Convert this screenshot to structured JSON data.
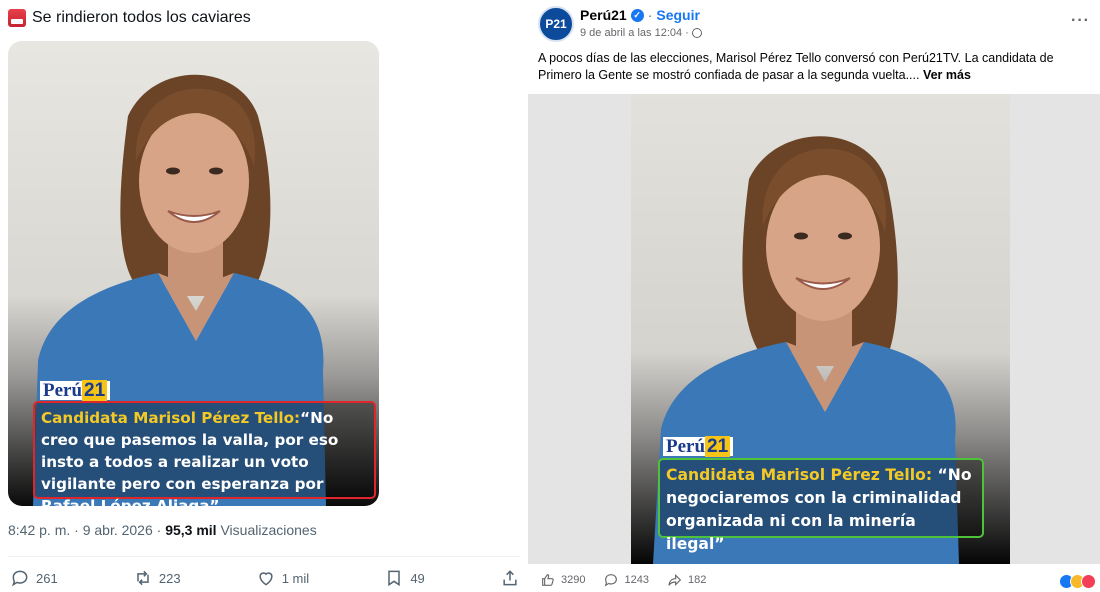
{
  "twitter": {
    "header_text": "Se rindieron todos los caviares",
    "header_emoji": "flag-emoji",
    "image": {
      "logo_text": "Perú",
      "logo_number": "21",
      "caption_prefix": "Candidata Marisol Pérez Tello:",
      "caption_quote": "“No creo que pasemos la valla, por eso insto a todos a realizar un voto vigilante pero con esperanza por Rafael López Aliaga”",
      "caption_border": "#e0262b"
    },
    "meta": {
      "time": "8:42 p. m. · 9 abr. 2026 · ",
      "views_count": "95,3 mil",
      "views_label": " Visualizaciones"
    },
    "actions": {
      "replies": "261",
      "reposts": "223",
      "likes": "1 mil",
      "bookmarks": "49"
    }
  },
  "facebook": {
    "page_name": "Perú21",
    "avatar_text": "P21",
    "follow_label": "Seguir",
    "timestamp": "9 de abril a las 12:04 ·",
    "post_text": "A pocos días de las elecciones, Marisol Pérez Tello conversó con Perú21TV. La candidata de Primero la Gente se mostró confiada de pasar a la segunda vuelta....",
    "see_more": "Ver más",
    "image": {
      "logo_text": "Perú",
      "logo_number": "21",
      "caption_prefix": "Candidata Marisol Pérez Tello:",
      "caption_quote": "“No negociaremos con la criminalidad organizada ni con la minería ilegal”",
      "caption_border": "#4fc23b"
    },
    "actions": {
      "likes": "3290",
      "comments": "1243",
      "shares": "182"
    },
    "reaction_colors": [
      "#1877f2",
      "#f7b928",
      "#f33e58"
    ]
  }
}
